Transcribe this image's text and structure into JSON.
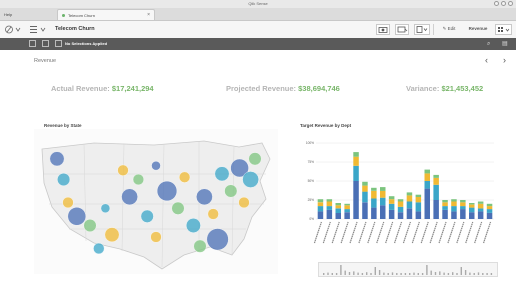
{
  "window": {
    "title": "Qlik Sense"
  },
  "tabs": [
    {
      "label": "Help"
    },
    {
      "label": "Telecom Churn"
    }
  ],
  "toolbar": {
    "app_name": "Telecom Churn",
    "edit_label": "Edit",
    "sheet_label": "Revenue"
  },
  "selections": {
    "text": "No Selections Applied"
  },
  "sheet": {
    "title": "Revenue"
  },
  "kpis": [
    {
      "label": "Actual Revenue:",
      "value": "$17,241,294"
    },
    {
      "label": "Projected Revenue:",
      "value": "$38,694,746"
    },
    {
      "label": "Variance:",
      "value": "$21,453,452"
    }
  ],
  "charts": {
    "map_title": "Revenue by State",
    "bar_title": "Target Revenue by Dept"
  },
  "colors": {
    "kpi_value": "#79b66a",
    "kpi_label": "#b5b5b5",
    "bar_blue": "#4a6fb5",
    "bar_teal": "#3aa6c8",
    "bar_yellow": "#f0b933",
    "bar_green": "#7cc47e"
  },
  "chart_data": {
    "type": "bar",
    "title": "Target Revenue by Dept",
    "ylim": [
      0,
      100
    ],
    "y_ticks": [
      "100%",
      "75%",
      "50%",
      "25%",
      "0%"
    ],
    "series": [
      {
        "values": [
          10,
          12,
          8,
          9,
          50,
          22,
          15,
          18,
          12,
          9,
          14,
          10,
          40,
          25,
          12,
          10,
          13,
          9,
          10,
          8
        ]
      },
      {
        "values": [
          7,
          5,
          6,
          4,
          20,
          14,
          12,
          10,
          8,
          7,
          9,
          12,
          10,
          20,
          5,
          7,
          4,
          6,
          4,
          5
        ]
      },
      {
        "values": [
          5,
          6,
          4,
          5,
          12,
          8,
          10,
          9,
          6,
          7,
          8,
          7,
          10,
          9,
          5,
          6,
          5,
          4,
          6,
          4
        ]
      },
      {
        "values": [
          4,
          3,
          3,
          2,
          6,
          5,
          4,
          5,
          4,
          3,
          4,
          3,
          5,
          4,
          3,
          3,
          3,
          2,
          3,
          3
        ]
      }
    ]
  },
  "map_data": {
    "bubbles": [
      [
        0.05,
        0.12,
        8,
        "#4a6fb5"
      ],
      [
        0.08,
        0.3,
        7,
        "#3aa6c8"
      ],
      [
        0.1,
        0.5,
        6,
        "#f0b933"
      ],
      [
        0.14,
        0.62,
        10,
        "#4a6fb5"
      ],
      [
        0.2,
        0.7,
        7,
        "#7cc47e"
      ],
      [
        0.27,
        0.55,
        5,
        "#3aa6c8"
      ],
      [
        0.3,
        0.78,
        8,
        "#f0b933"
      ],
      [
        0.38,
        0.45,
        9,
        "#4a6fb5"
      ],
      [
        0.42,
        0.3,
        6,
        "#7cc47e"
      ],
      [
        0.46,
        0.62,
        7,
        "#3aa6c8"
      ],
      [
        0.5,
        0.8,
        6,
        "#f0b933"
      ],
      [
        0.55,
        0.4,
        11,
        "#4a6fb5"
      ],
      [
        0.6,
        0.55,
        7,
        "#7cc47e"
      ],
      [
        0.63,
        0.28,
        6,
        "#f0b933"
      ],
      [
        0.67,
        0.7,
        8,
        "#3aa6c8"
      ],
      [
        0.72,
        0.45,
        9,
        "#4a6fb5"
      ],
      [
        0.76,
        0.6,
        6,
        "#f0b933"
      ],
      [
        0.8,
        0.25,
        8,
        "#3aa6c8"
      ],
      [
        0.84,
        0.4,
        7,
        "#7cc47e"
      ],
      [
        0.88,
        0.2,
        10,
        "#4a6fb5"
      ],
      [
        0.9,
        0.5,
        6,
        "#f0b933"
      ],
      [
        0.93,
        0.3,
        9,
        "#3aa6c8"
      ],
      [
        0.78,
        0.82,
        12,
        "#4a6fb5"
      ],
      [
        0.7,
        0.88,
        7,
        "#7cc47e"
      ],
      [
        0.24,
        0.9,
        6,
        "#3aa6c8"
      ],
      [
        0.5,
        0.18,
        5,
        "#4a6fb5"
      ],
      [
        0.35,
        0.22,
        6,
        "#f0b933"
      ],
      [
        0.95,
        0.12,
        7,
        "#7cc47e"
      ]
    ]
  }
}
